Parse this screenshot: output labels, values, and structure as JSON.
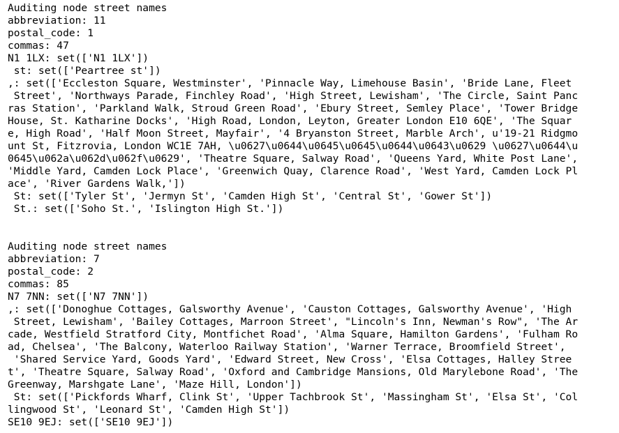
{
  "output": {
    "blocks": [
      {
        "lines": [
          "Auditing node street names",
          "abbreviation: 11",
          "postal_code: 1",
          "commas: 47",
          "N1 1LX: set(['N1 1LX'])",
          " st: set(['Peartree st'])",
          ",: set(['Eccleston Square, Westminster', 'Pinnacle Way, Limehouse Basin', 'Bride Lane, Fleet",
          " Street', 'Northways Parade, Finchley Road', 'High Street, Lewisham', 'The Circle, Saint Panc",
          "ras Station', 'Parkland Walk, Stroud Green Road', 'Ebury Street, Semley Place', 'Tower Bridge",
          "House, St. Katharine Docks', 'High Road, London, Leyton, Greater London E10 6QE', 'The Squar",
          "e, High Road', 'Half Moon Street, Mayfair', '4 Bryanston Street, Marble Arch', u'19-21 Ridgmo",
          "unt St, Fitzrovia, London WC1E 7AH, \\u0627\\u0644\\u0645\\u0645\\u0644\\u0643\\u0629 \\u0627\\u0644\\u",
          "0645\\u062a\\u062d\\u062f\\u0629', 'Theatre Square, Salway Road', 'Queens Yard, White Post Lane',",
          "'Middle Yard, Camden Lock Place', 'Greenwich Quay, Clarence Road', 'West Yard, Camden Lock Pl",
          "ace', 'River Gardens Walk,'])",
          " St: set(['Tyler St', 'Jermyn St', 'Camden High St', 'Central St', 'Gower St'])",
          " St.: set(['Soho St.', 'Islington High St.'])"
        ]
      },
      {
        "lines": [
          "Auditing node street names",
          "abbreviation: 7",
          "postal_code: 2",
          "commas: 85",
          "N7 7NN: set(['N7 7NN'])",
          ",: set(['Donoghue Cottages, Galsworthy Avenue', 'Causton Cottages, Galsworthy Avenue', 'High",
          " Street, Lewisham', 'Bailey Cottages, Marroon Street', \"Lincoln's Inn, Newman's Row\", 'The Ar",
          "cade, Westfield Stratford City, Montfichet Road', 'Alma Square, Hamilton Gardens', 'Fulham Ro",
          "ad, Chelsea', 'The Balcony, Waterloo Railway Station', 'Warner Terrace, Broomfield Street',",
          " 'Shared Service Yard, Goods Yard', 'Edward Street, New Cross', 'Elsa Cottages, Halley Stree",
          "t', 'Theatre Square, Salway Road', 'Oxford and Cambridge Mansions, Old Marylebone Road', 'The",
          "Greenway, Marshgate Lane', 'Maze Hill, London'])",
          " St: set(['Pickfords Wharf, Clink St', 'Upper Tachbrook St', 'Massingham St', 'Elsa St', 'Col",
          "lingwood St', 'Leonard St', 'Camden High St'])",
          "SE10 9EJ: set(['SE10 9EJ'])"
        ]
      }
    ]
  }
}
